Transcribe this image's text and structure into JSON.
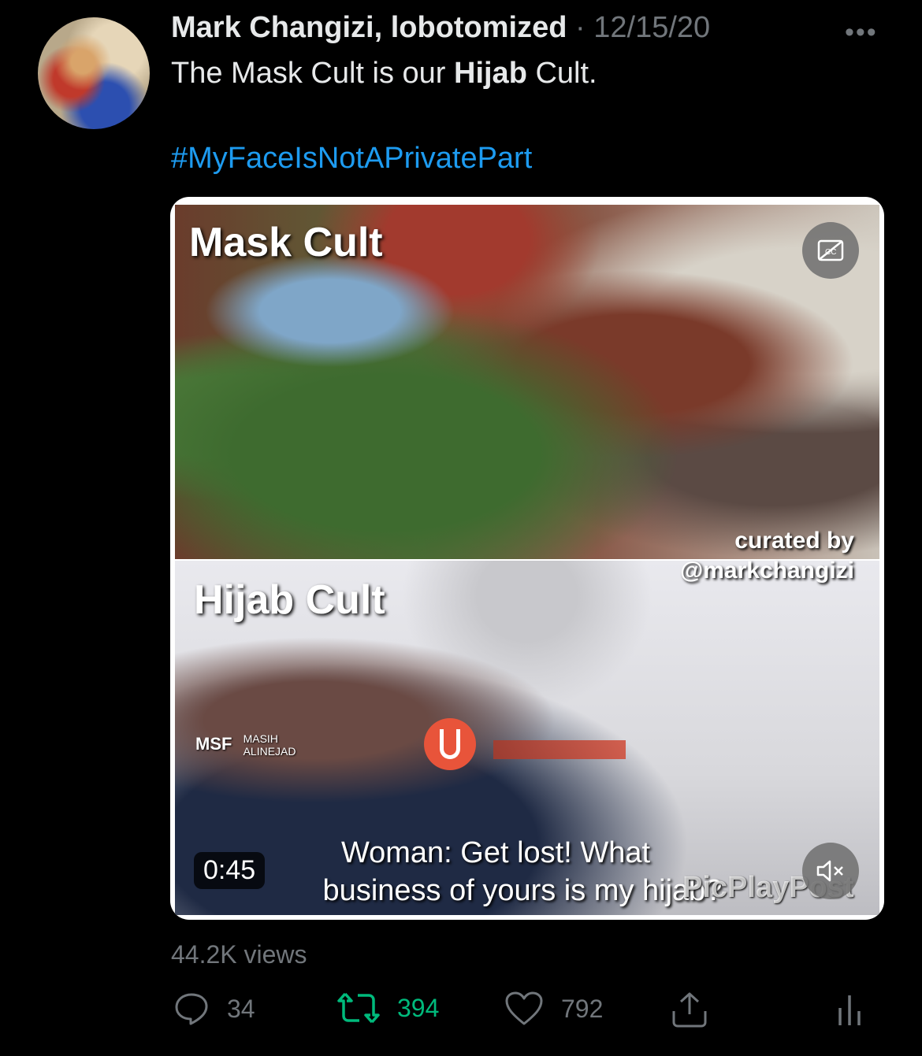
{
  "tweet": {
    "author_name": "Mark Changizi, lobotomized",
    "separator": "·",
    "date": "12/15/20",
    "more_label": "•••",
    "text_prefix": "The Mask Cult is our ",
    "text_bold": "Hijab",
    "text_suffix": " Cult.",
    "hashtag": "#MyFaceIsNotAPrivatePart"
  },
  "video": {
    "label_top": "Mask Cult",
    "label_bottom": "Hijab Cult",
    "curated_line1": "curated by",
    "curated_line2": "@markchangizi",
    "logo_msf": "MSF",
    "logo_msf_sub1": "MASIH",
    "logo_msf_sub2": "ALINEJAD",
    "caption_line1": "Woman: Get lost! What",
    "caption_line2": "business of yours is my hijab?",
    "watermark": "PicPlayPost",
    "duration": "0:45",
    "cc_label": "CC",
    "mute_label": "🔇"
  },
  "stats": {
    "views": "44.2K views",
    "replies": "34",
    "retweets": "394",
    "likes": "792"
  },
  "colors": {
    "accent": "#1d9bf0",
    "retweet": "#00ba7c",
    "muted": "#71767b"
  }
}
